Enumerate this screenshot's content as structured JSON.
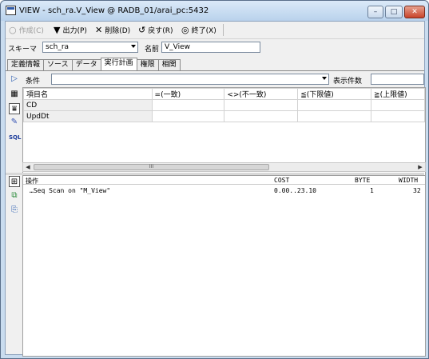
{
  "window": {
    "title": "VIEW - sch_ra.V_View @ RADB_01/arai_pc:5432",
    "min_glyph": "–",
    "max_glyph": "□",
    "close_glyph": "✕"
  },
  "toolbar": {
    "create": "作成(C)",
    "output": "出力(P)",
    "delete": "削除(D)",
    "revert": "戻す(R)",
    "exit": "終了(X)"
  },
  "schema_row": {
    "schema_label": "スキーマ",
    "schema_value": "sch_ra",
    "name_label": "名前",
    "name_value": "V_View"
  },
  "tabs": [
    "定義情報",
    "ソース",
    "データ",
    "実行計画",
    "権限",
    "相関"
  ],
  "active_tab": "実行計画",
  "condition": {
    "label": "条件",
    "value": "",
    "count_label": "表示件数",
    "count_value": ""
  },
  "filter_grid": {
    "columns": [
      "項目名",
      "=(一致)",
      "<>(不一致)",
      "≦(下限値)",
      "≧(上限値)"
    ],
    "rows": [
      [
        "CD",
        "",
        "",
        "",
        ""
      ],
      [
        "UpdDt",
        "",
        "",
        "",
        ""
      ]
    ]
  },
  "sidebar_sql_label": "SQL",
  "scroll_thumb_label": "III",
  "plan": {
    "columns": {
      "operation": "操作",
      "cost": "COST",
      "byte": "BYTE",
      "width": "WIDTH"
    },
    "rows": [
      {
        "operation": "…Seq Scan on \"M_View\"",
        "cost": "0.00..23.10",
        "byte": "1",
        "width": "32"
      }
    ]
  }
}
